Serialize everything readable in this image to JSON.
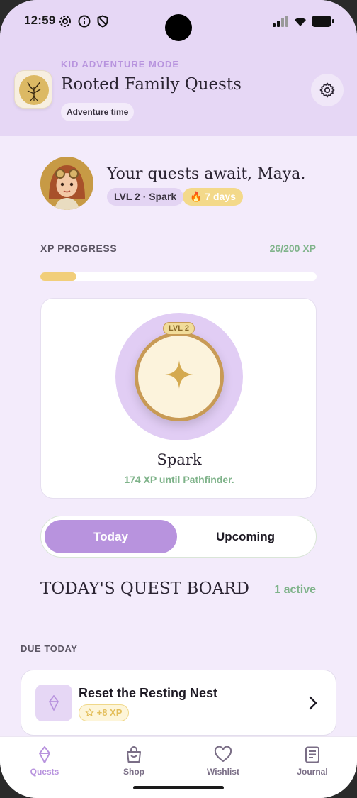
{
  "status_bar": {
    "time": "12:59"
  },
  "header": {
    "mode_label": "KID ADVENTURE MODE",
    "title": "Rooted Family Quests",
    "chip": "Adventure time"
  },
  "profile": {
    "greeting": "Your quests await, Maya.",
    "level_chip": "LVL 2 · Spark",
    "streak_chip": "🔥 7 days"
  },
  "xp": {
    "label": "XP PROGRESS",
    "value_text": "26/200 XP",
    "progress_fraction": 0.13
  },
  "level_card": {
    "badge": "LVL 2",
    "name": "Spark",
    "subtitle": "174 XP until Pathfinder."
  },
  "tabs_segment": {
    "today": "Today",
    "upcoming": "Upcoming",
    "selected": "Today"
  },
  "board": {
    "title": "TODAY'S QUEST BOARD",
    "count": "1 active",
    "section_label": "DUE TODAY"
  },
  "quests": [
    {
      "title": "Reset the Resting Nest",
      "xp": "+8 XP"
    }
  ],
  "tab_bar": [
    {
      "label": "Quests",
      "icon": "crystal-icon",
      "active": true
    },
    {
      "label": "Shop",
      "icon": "shop-bag-icon",
      "active": false
    },
    {
      "label": "Wishlist",
      "icon": "heart-icon",
      "active": false
    },
    {
      "label": "Journal",
      "icon": "journal-icon",
      "active": false
    }
  ],
  "colors": {
    "accent_purple": "#b893de",
    "header_bg": "#e6d7f5",
    "page_bg": "#f3ebfb",
    "xp_green": "#7fb38a",
    "gold": "#f1ce7a"
  }
}
